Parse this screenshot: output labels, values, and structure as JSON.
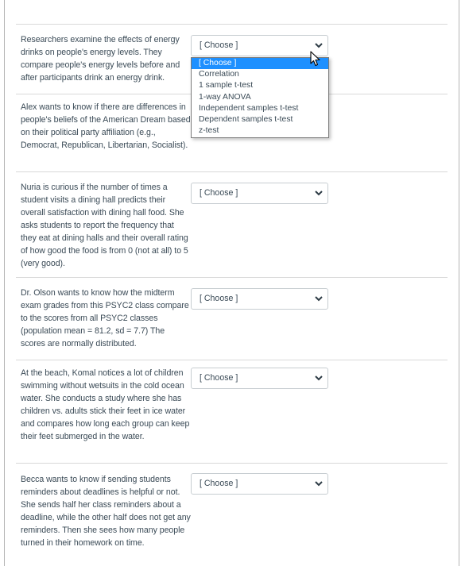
{
  "questions": [
    {
      "prompt": "Researchers examine the effects of energy drinks on people's energy levels. They compare people's energy levels before and after participants drink an energy drink.",
      "selected": "[ Choose ]",
      "open": true
    },
    {
      "prompt": "Alex wants to know if there are differences in people's beliefs of the American Dream based on their political party affiliation (e.g., Democrat, Republican, Libertarian, Socialist).",
      "selected": "[ Choose ]",
      "open": false
    },
    {
      "prompt": "Nuria is curious if the number of times a student visits a dining hall predicts their overall satisfaction with dining hall food. She asks students to report the frequency that they eat at dining halls and their overall rating of how good the food is from 0 (not at all) to 5 (very good).",
      "selected": "[ Choose ]",
      "open": false
    },
    {
      "prompt": "Dr. Olson wants to know how the midterm exam grades from this PSYC2 class compare to the scores from all PSYC2 classes (population mean = 81.2, sd = 7.7) The scores are normally distributed.",
      "selected": "[ Choose ]",
      "open": false
    },
    {
      "prompt": "At the beach, Komal notices a lot of children swimming without wetsuits in the cold ocean water. She conducts a study where she has children vs. adults stick their feet in ice water and compares how long each group can keep their feet submerged in the water.",
      "selected": "[ Choose ]",
      "open": false
    },
    {
      "prompt": "Becca wants to know if sending students reminders about deadlines is helpful or not. She sends half her class reminders about a deadline, while the other half does not get any reminders. Then she sees how many people turned in their homework on time.",
      "selected": "[ Choose ]",
      "open": false
    }
  ],
  "dropdown_options": [
    "[ Choose ]",
    "Correlation",
    "1 sample t-test",
    "1-way ANOVA",
    "Independent samples t-test",
    "Dependent samples t-test",
    "z-test"
  ],
  "dropdown_highlighted_index": 0,
  "colors": {
    "highlight": "#1e90ff",
    "text": "#3a4a56",
    "border": "#c7cdd1"
  }
}
